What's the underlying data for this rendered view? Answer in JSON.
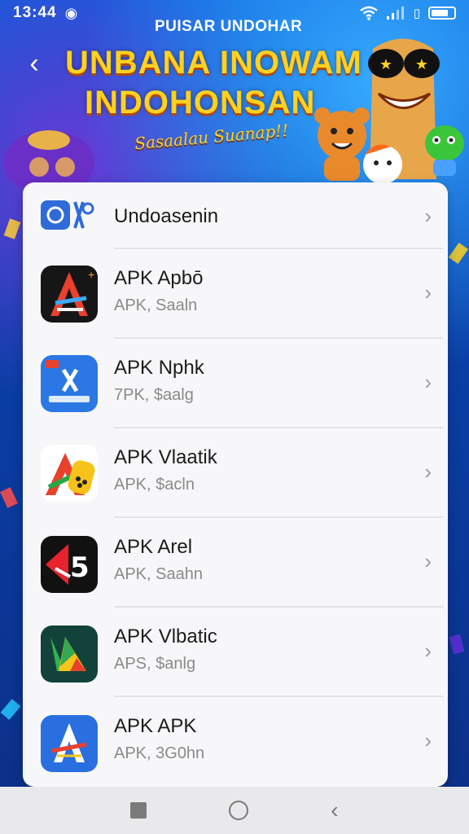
{
  "status_bar": {
    "time": "13:44",
    "icons": [
      "notification-icon",
      "wifi-icon",
      "signal-icon",
      "battery-icon"
    ]
  },
  "header": {
    "brand": "PUISAR UNDOHAR",
    "title_line_1": "UNBANA INOWAM",
    "title_line_2": "INDOHONSAN",
    "subtitle": "Sasaalau Suanap!!"
  },
  "list": [
    {
      "name": "Undoasenin",
      "meta": "",
      "icon": "undoasenin-app-icon"
    },
    {
      "name": "APK Apbō",
      "meta": "APK, Saaln",
      "icon": "apk-apbo-app-icon"
    },
    {
      "name": "APK Nphk",
      "meta": "7PK, $aalg",
      "icon": "apk-nphk-app-icon"
    },
    {
      "name": "APK Vlaatik",
      "meta": "APK, $acln",
      "icon": "apk-vlaatik-app-icon"
    },
    {
      "name": "APK Arel",
      "meta": "APK, Saahn",
      "icon": "apk-arel-app-icon"
    },
    {
      "name": "APK Vlbatic",
      "meta": "APS, $anlg",
      "icon": "apk-vlbatic-app-icon"
    },
    {
      "name": "APK APK",
      "meta": "APK, 3G0hn",
      "icon": "apk-apk-app-icon"
    }
  ],
  "colors": {
    "background_blue": "#0b5fd9",
    "title_yellow": "#ffd21f",
    "card_bg": "#f7f7f9"
  },
  "nav": {
    "buttons": [
      "recent-apps-button",
      "home-button",
      "back-button"
    ]
  }
}
